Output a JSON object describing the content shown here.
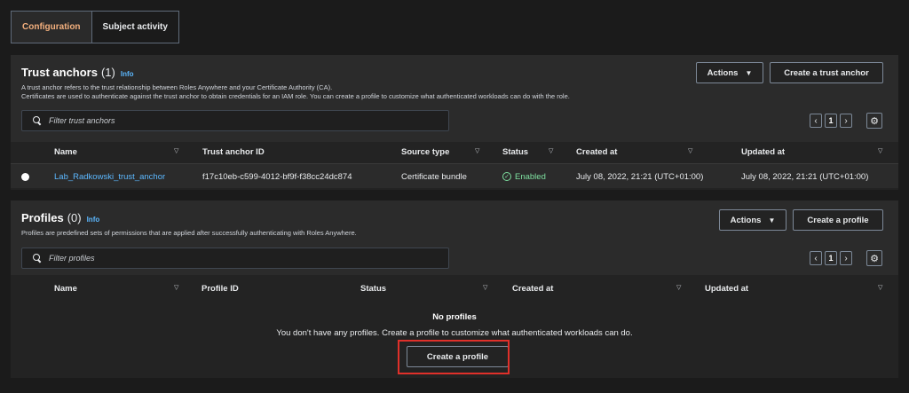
{
  "tabs": [
    {
      "label": "Configuration",
      "active": true
    },
    {
      "label": "Subject activity",
      "active": false
    }
  ],
  "trust_anchors": {
    "title": "Trust anchors",
    "count": "(1)",
    "info": "Info",
    "description_line1": "A trust anchor refers to the trust relationship between Roles Anywhere and your Certificate Authority (CA).",
    "description_line2": "Certificates are used to authenticate against the trust anchor to obtain credentials for an IAM role. You can create a profile to customize what authenticated workloads can do with the role.",
    "actions_label": "Actions",
    "create_label": "Create a trust anchor",
    "filter_placeholder": "Filter trust anchors",
    "page": "1",
    "columns": [
      "Name",
      "Trust anchor ID",
      "Source type",
      "Status",
      "Created at",
      "Updated at"
    ],
    "rows": [
      {
        "name": "Lab_Radkowski_trust_anchor",
        "id": "f17c10eb-c599-4012-bf9f-f38cc24dc874",
        "source_type": "Certificate bundle",
        "status": "Enabled",
        "created_at": "July 08, 2022, 21:21 (UTC+01:00)",
        "updated_at": "July 08, 2022, 21:21 (UTC+01:00)"
      }
    ]
  },
  "profiles": {
    "title": "Profiles",
    "count": "(0)",
    "info": "Info",
    "description": "Profiles are predefined sets of permissions that are applied after successfully authenticating with Roles Anywhere.",
    "actions_label": "Actions",
    "create_label": "Create a profile",
    "filter_placeholder": "Filter profiles",
    "page": "1",
    "columns": [
      "Name",
      "Profile ID",
      "Status",
      "Created at",
      "Updated at"
    ],
    "empty_title": "No profiles",
    "empty_message": "You don't have any profiles. Create a profile to customize what authenticated workloads can do.",
    "empty_create_label": "Create a profile"
  },
  "colors": {
    "accent_link": "#5cb8ff",
    "active_tab": "#f4b07e",
    "status_enabled": "#7ee0a0",
    "highlight": "#e0302a"
  }
}
